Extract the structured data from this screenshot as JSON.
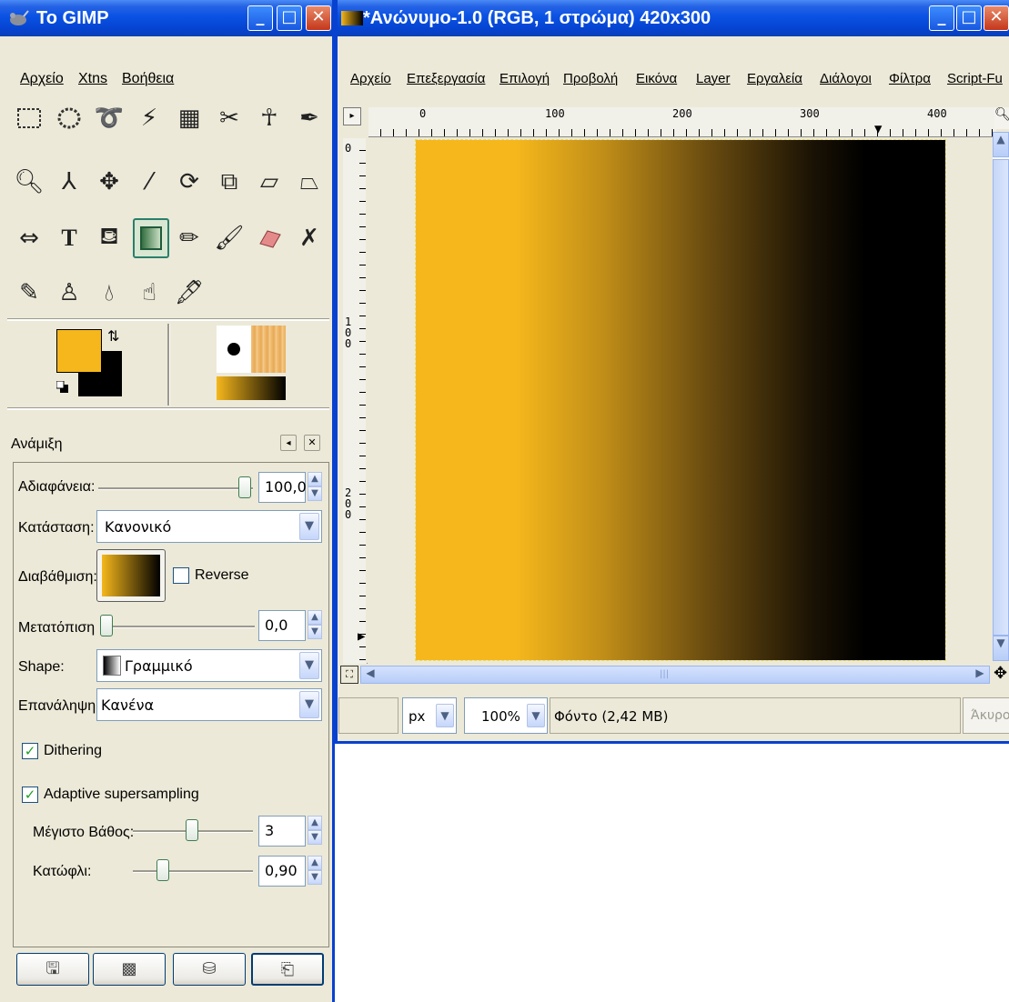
{
  "toolbox": {
    "title": "To GIMP",
    "menu": [
      "Αρχείο",
      "Xtns",
      "Βοήθεια"
    ],
    "options_title": "Ανάμιξη",
    "opacity": {
      "label": "Αδιαφάνεια:",
      "value": "100,0"
    },
    "mode": {
      "label": "Κατάσταση:",
      "value": "Κανονικό"
    },
    "gradient": {
      "label": "Διαβάθμιση:",
      "reverse_label": "Reverse",
      "reverse_checked": false
    },
    "offset": {
      "label": "Μετατόπιση",
      "value": "0,0"
    },
    "shape": {
      "label": "Shape:",
      "value": "Γραμμικό"
    },
    "repeat": {
      "label": "Επανάληψη:",
      "value": "Κανένα"
    },
    "dithering": {
      "label": "Dithering",
      "checked": true
    },
    "adaptive": {
      "label": "Adaptive supersampling",
      "checked": true
    },
    "max_depth": {
      "label": "Μέγιστο Βάθος:",
      "value": "3"
    },
    "threshold": {
      "label": "Κατώφλι:",
      "value": "0,90"
    },
    "fg_color": "#f5b71c",
    "bg_color": "#000000"
  },
  "image_window": {
    "title": "*Ανώνυμο-1.0 (RGB, 1 στρώμα) 420x300",
    "menu": [
      "Αρχείο",
      "Επεξεργασία",
      "Επιλογή",
      "Προβολή",
      "Εικόνα",
      "Layer",
      "Εργαλεία",
      "Διάλογοι",
      "Φίλτρα",
      "Script-Fu"
    ],
    "ruler_h_labels": [
      "0",
      "100",
      "200",
      "300",
      "400"
    ],
    "ruler_v_labels": [
      "0",
      "100",
      "200"
    ],
    "unit": "px",
    "zoom": "100%",
    "status": "Φόντο (2,42 MB)",
    "cancel_label": "Άκυρο"
  }
}
